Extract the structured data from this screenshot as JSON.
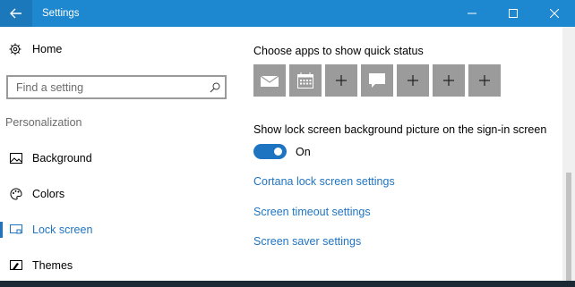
{
  "window": {
    "title": "Settings"
  },
  "sidebar": {
    "home_label": "Home",
    "search_placeholder": "Find a setting",
    "section": "Personalization",
    "items": [
      {
        "label": "Background",
        "icon": "picture-icon"
      },
      {
        "label": "Colors",
        "icon": "palette-icon"
      },
      {
        "label": "Lock screen",
        "icon": "lock-screen-icon",
        "active": true
      },
      {
        "label": "Themes",
        "icon": "themes-icon"
      }
    ]
  },
  "main": {
    "quick_status_label": "Choose apps to show quick status",
    "quick_status_apps": [
      "mail-icon",
      "calendar-icon",
      "plus-icon",
      "message-icon",
      "plus-icon",
      "plus-icon",
      "plus-icon"
    ],
    "signin_label": "Show lock screen background picture on the sign-in screen",
    "toggle_state": "On",
    "links": {
      "cortana": "Cortana lock screen settings",
      "timeout": "Screen timeout settings",
      "saver": "Screen saver settings"
    }
  },
  "colors": {
    "accent": "#1f74c2",
    "titlebar": "#1d87d0",
    "tile": "#9b9b9b"
  }
}
